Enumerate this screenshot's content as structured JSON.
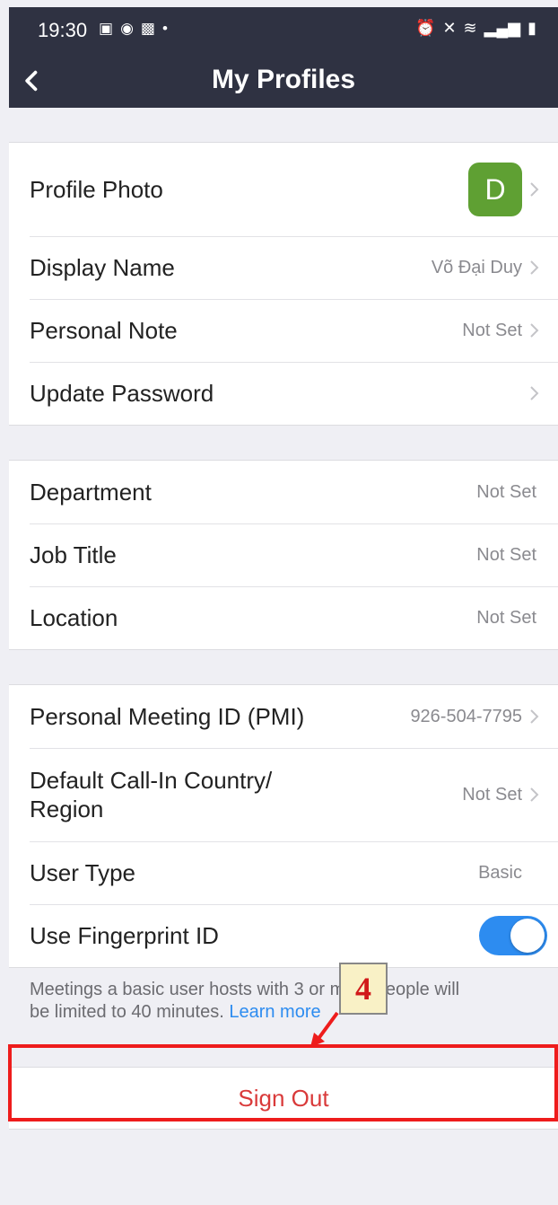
{
  "status_bar": {
    "time": "19:30",
    "left_icons": [
      "image-icon",
      "messenger-icon",
      "gallery-icon",
      "dot-icon"
    ],
    "right_icons": [
      "alarm-icon",
      "mute-icon",
      "wifi-icon",
      "volte-icon",
      "signal-icon",
      "battery-icon"
    ]
  },
  "nav": {
    "title": "My Profiles",
    "back_icon": "chevron-left-icon"
  },
  "profile_section": {
    "photo_label": "Profile Photo",
    "avatar_letter": "D",
    "avatar_color": "#5fa033",
    "display_name_label": "Display Name",
    "display_name_value": "Võ Đại Duy",
    "personal_note_label": "Personal Note",
    "personal_note_value": "Not Set",
    "update_password_label": "Update Password"
  },
  "org_section": {
    "department_label": "Department",
    "department_value": "Not Set",
    "job_title_label": "Job Title",
    "job_title_value": "Not Set",
    "location_label": "Location",
    "location_value": "Not Set"
  },
  "meeting_section": {
    "pmi_label": "Personal Meeting ID (PMI)",
    "pmi_value": "926-504-7795",
    "callin_label_line1": "Default Call-In Country/",
    "callin_label_line2": "Region",
    "callin_value": "Not Set",
    "user_type_label": "User Type",
    "user_type_value": "Basic",
    "fingerprint_label": "Use Fingerprint ID",
    "fingerprint_enabled": true,
    "toggle_color": "#2d8cf0"
  },
  "footnote": {
    "text_line1": "Meetings a basic user hosts with 3 or more people will",
    "text_line2": "be limited to 40 minutes.",
    "link": "Learn more"
  },
  "sign_out_label": "Sign Out",
  "annotation": {
    "step": "4",
    "color": "#ee1c1c"
  }
}
